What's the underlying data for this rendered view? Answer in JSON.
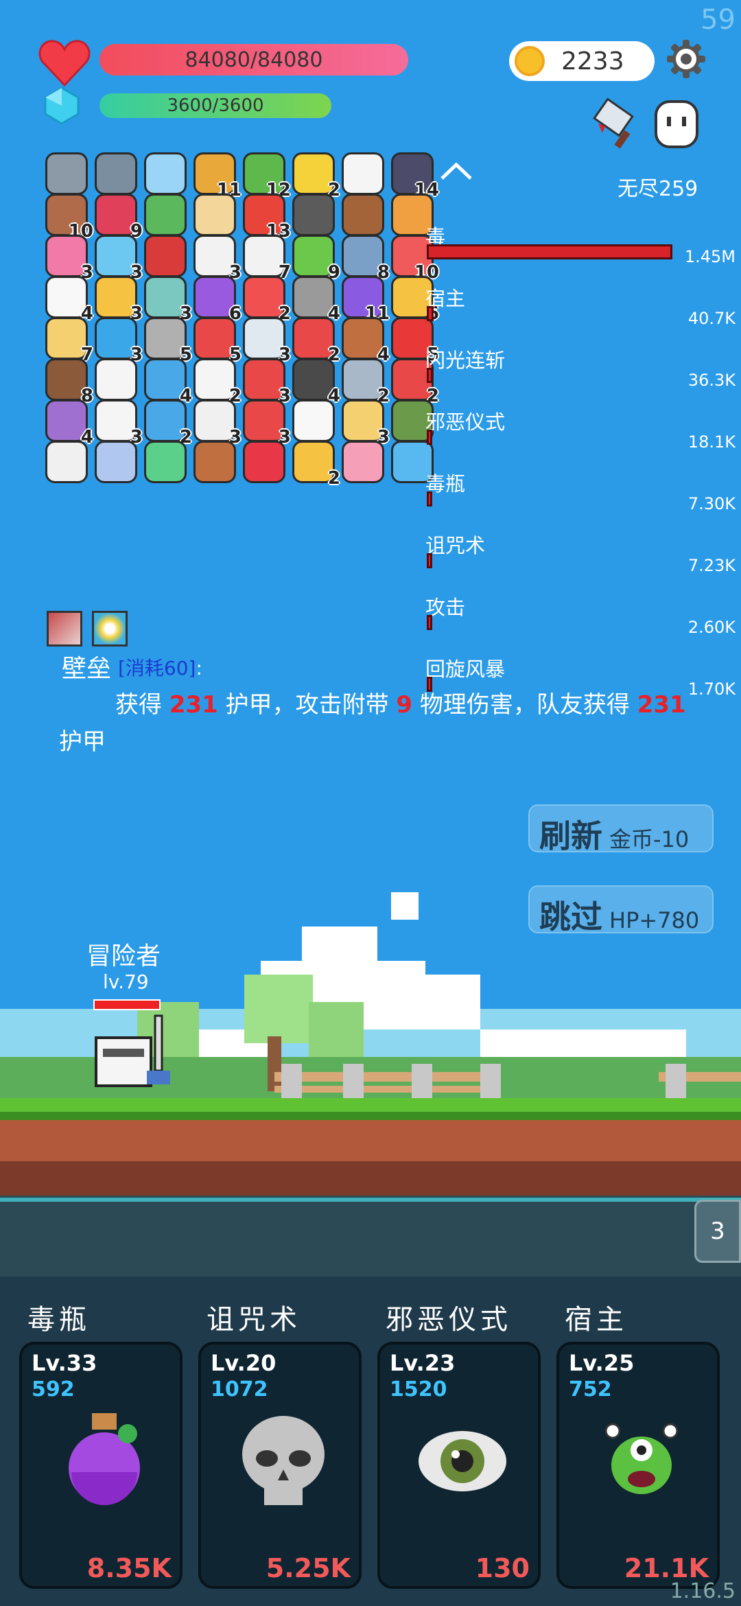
{
  "fps": "59",
  "version": "1.16.5",
  "hp": {
    "text": "84080/84080",
    "fraction": 1.0
  },
  "mp": {
    "text": "3600/3600",
    "fraction": 1.0
  },
  "gold": "2233",
  "mode": "无尽259",
  "items": [
    {
      "icon": "axe-icon",
      "color": "#8c9aa8",
      "count": ""
    },
    {
      "icon": "mortar-icon",
      "color": "#7a8ea0",
      "count": ""
    },
    {
      "icon": "magnifier-icon",
      "color": "#9ad4f6",
      "count": ""
    },
    {
      "icon": "book-icon",
      "color": "#e9a83a",
      "count": "11"
    },
    {
      "icon": "turtle-shell-icon",
      "color": "#5fb84b",
      "count": "12"
    },
    {
      "icon": "bulb-icon",
      "color": "#f5d13a",
      "count": "2"
    },
    {
      "icon": "love-letter-icon",
      "color": "#f5f5f5",
      "count": ""
    },
    {
      "icon": "bat-icon",
      "color": "#4c4c6a",
      "count": "14"
    },
    {
      "icon": "door-icon",
      "color": "#b06b4a",
      "count": "10"
    },
    {
      "icon": "jam-icon",
      "color": "#e0405a",
      "count": "9"
    },
    {
      "icon": "cash-icon",
      "color": "#5cb85c",
      "count": ""
    },
    {
      "icon": "map-icon",
      "color": "#f3d79a",
      "count": ""
    },
    {
      "icon": "sock-icon",
      "color": "#e8443a",
      "count": "13"
    },
    {
      "icon": "helmet-icon",
      "color": "#5b5b5b",
      "count": ""
    },
    {
      "icon": "chest-icon",
      "color": "#a4643a",
      "count": ""
    },
    {
      "icon": "meteor-icon",
      "color": "#f0a040",
      "count": ""
    },
    {
      "icon": "potion-pink-icon",
      "color": "#f27aa8",
      "count": "3"
    },
    {
      "icon": "bubble-icon",
      "color": "#6cc8f0",
      "count": "3"
    },
    {
      "icon": "magnet-icon",
      "color": "#d93b3b",
      "count": ""
    },
    {
      "icon": "flower-icon",
      "color": "#f2f2f2",
      "count": "3"
    },
    {
      "icon": "dice-icon",
      "color": "#f2f2f2",
      "count": "7"
    },
    {
      "icon": "zombie-icon",
      "color": "#6cc84b",
      "count": "9"
    },
    {
      "icon": "shield-icon",
      "color": "#7aa0c8",
      "count": "8"
    },
    {
      "icon": "gift-icon",
      "color": "#f05a5a",
      "count": "10"
    },
    {
      "icon": "ghost-icon",
      "color": "#f8f8f8",
      "count": "4"
    },
    {
      "icon": "ring-icon",
      "color": "#f5c242",
      "count": "3"
    },
    {
      "icon": "target-icon",
      "color": "#7ac8c0",
      "count": "3"
    },
    {
      "icon": "crystal-ball-icon",
      "color": "#9a5ae0",
      "count": "6"
    },
    {
      "icon": "pill-icon",
      "color": "#f05050",
      "count": "2"
    },
    {
      "icon": "spike-ball-icon",
      "color": "#9a9a9a",
      "count": "4"
    },
    {
      "icon": "purple-box-icon",
      "color": "#8a5ae0",
      "count": "11"
    },
    {
      "icon": "star-wand-icon",
      "color": "#f5c242",
      "count": "6"
    },
    {
      "icon": "note-icon",
      "color": "#f5d070",
      "count": "7"
    },
    {
      "icon": "sapphire-icon",
      "color": "#3aa8e8",
      "count": "3"
    },
    {
      "icon": "compass-icon",
      "color": "#b0b0b0",
      "count": "5"
    },
    {
      "icon": "watermelon-icon",
      "color": "#e84848",
      "count": "5"
    },
    {
      "icon": "clipboard-icon",
      "color": "#e0e8f0",
      "count": "3"
    },
    {
      "icon": "hearts-icon",
      "color": "#e84848",
      "count": "2"
    },
    {
      "icon": "round-shield-icon",
      "color": "#c07040",
      "count": "4"
    },
    {
      "icon": "apple-icon",
      "color": "#e83838",
      "count": "5"
    },
    {
      "icon": "coconut-icon",
      "color": "#8a5a3a",
      "count": "8"
    },
    {
      "icon": "chat-icon",
      "color": "#f5f5f5",
      "count": ""
    },
    {
      "icon": "speech-icon",
      "color": "#48a8e8",
      "count": "4"
    },
    {
      "icon": "cloud-icon",
      "color": "#f5f5f5",
      "count": "2"
    },
    {
      "icon": "mushroom-icon",
      "color": "#e84848",
      "count": "3"
    },
    {
      "icon": "cauldron-icon",
      "color": "#4a4a4a",
      "count": "4"
    },
    {
      "icon": "sword-icon",
      "color": "#a8b8c8",
      "count": "2"
    },
    {
      "icon": "heart-icon",
      "color": "#e84848",
      "count": "2"
    },
    {
      "icon": "purple-shield-icon",
      "color": "#a070d0",
      "count": "4"
    },
    {
      "icon": "cards-icon",
      "color": "#f5f5f5",
      "count": "3"
    },
    {
      "icon": "monitor-icon",
      "color": "#48a8e8",
      "count": "2"
    },
    {
      "icon": "lightbulb-icon",
      "color": "#f0f0f0",
      "count": "3"
    },
    {
      "icon": "thermometer-icon",
      "color": "#e84848",
      "count": "3"
    },
    {
      "icon": "egg-icon",
      "color": "#f8f8f8",
      "count": ""
    },
    {
      "icon": "halo-icon",
      "color": "#f5d070",
      "count": "3"
    },
    {
      "icon": "grenade-icon",
      "color": "#6a9a4a",
      "count": ""
    },
    {
      "icon": "envelope-icon",
      "color": "#f0f0f0",
      "count": ""
    },
    {
      "icon": "capsule-icon",
      "color": "#b0c8f0",
      "count": ""
    },
    {
      "icon": "sprout-icon",
      "color": "#5ad08a",
      "count": ""
    },
    {
      "icon": "bow-icon",
      "color": "#c07040",
      "count": ""
    },
    {
      "icon": "strawberry-icon",
      "color": "#e83848",
      "count": ""
    },
    {
      "icon": "crown-icon",
      "color": "#f5c242",
      "count": "2"
    },
    {
      "icon": "ice-cream-icon",
      "color": "#f5a0b8",
      "count": ""
    },
    {
      "icon": "scroll-icon",
      "color": "#58b8f0",
      "count": ""
    }
  ],
  "damage_list": [
    {
      "name": "毒",
      "value": "1.45M",
      "fraction": 1.0
    },
    {
      "name": "宿主",
      "value": "40.7K",
      "fraction": 0.028
    },
    {
      "name": "闪光连斩",
      "value": "36.3K",
      "fraction": 0.025
    },
    {
      "name": "邪恶仪式",
      "value": "18.1K",
      "fraction": 0.013
    },
    {
      "name": "毒瓶",
      "value": "7.30K",
      "fraction": 0.005
    },
    {
      "name": "诅咒术",
      "value": "7.23K",
      "fraction": 0.005
    },
    {
      "name": "攻击",
      "value": "2.60K",
      "fraction": 0.002
    },
    {
      "name": "回旋风暴",
      "value": "1.70K",
      "fraction": 0.001
    }
  ],
  "skill": {
    "title": "壁垒",
    "cost": "[消耗60]",
    "colon": ":",
    "desc_1": "获得",
    "armor": "231",
    "desc_2": "护甲，攻击附带",
    "dmg": "9",
    "desc_3": "物理伤害，队友获得",
    "armor2": "231",
    "desc_4": "护甲"
  },
  "refresh": {
    "label": "刷新",
    "sub": "金币-10"
  },
  "skip": {
    "label": "跳过",
    "sub": "HP+780"
  },
  "hero": {
    "name": "冒险者",
    "level": "lv.79"
  },
  "tab_count": "3",
  "cards": [
    {
      "title": "毒瓶",
      "level": "Lv.33",
      "num": "592",
      "damage": "8.35K",
      "icon": "potion-icon"
    },
    {
      "title": "诅咒术",
      "level": "Lv.20",
      "num": "1072",
      "damage": "5.25K",
      "icon": "skull-icon"
    },
    {
      "title": "邪恶仪式",
      "level": "Lv.23",
      "num": "1520",
      "damage": "130",
      "icon": "eye-icon"
    },
    {
      "title": "宿主",
      "level": "Lv.25",
      "num": "752",
      "damage": "21.1K",
      "icon": "monster-icon"
    }
  ]
}
